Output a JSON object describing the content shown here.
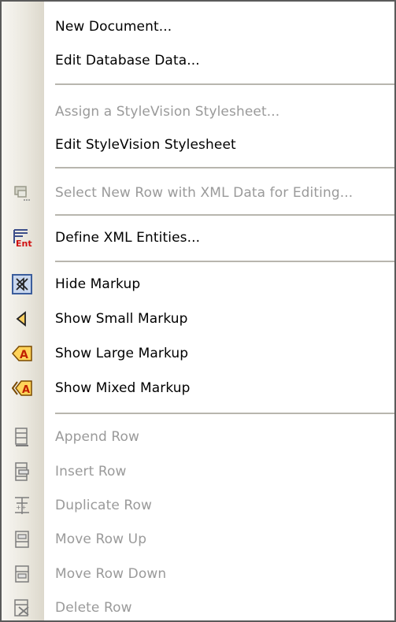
{
  "menu": {
    "items": [
      {
        "label": "New Document...",
        "enabled": true
      },
      {
        "label": "Edit Database Data...",
        "enabled": true
      },
      {
        "label": "Assign a StyleVision Stylesheet...",
        "enabled": false
      },
      {
        "label": "Edit StyleVision Stylesheet",
        "enabled": true
      },
      {
        "label": "Select New Row with XML Data for Editing...",
        "enabled": false,
        "icon": "xml-row-icon"
      },
      {
        "label": "Define XML Entities...",
        "enabled": true,
        "icon": "entities-icon"
      },
      {
        "label": "Hide Markup",
        "enabled": true,
        "icon": "hide-markup-icon",
        "checked": true
      },
      {
        "label": "Show Small Markup",
        "enabled": true,
        "icon": "small-markup-icon"
      },
      {
        "label": "Show Large Markup",
        "enabled": true,
        "icon": "large-markup-icon"
      },
      {
        "label": "Show Mixed Markup",
        "enabled": true,
        "icon": "mixed-markup-icon"
      },
      {
        "label": "Append Row",
        "enabled": false,
        "icon": "append-row-icon"
      },
      {
        "label": "Insert Row",
        "enabled": false,
        "icon": "insert-row-icon"
      },
      {
        "label": "Duplicate Row",
        "enabled": false,
        "icon": "duplicate-row-icon"
      },
      {
        "label": "Move Row Up",
        "enabled": false,
        "icon": "move-row-up-icon"
      },
      {
        "label": "Move Row Down",
        "enabled": false,
        "icon": "move-row-down-icon"
      },
      {
        "label": "Delete Row",
        "enabled": false,
        "icon": "delete-row-icon"
      }
    ]
  },
  "colors": {
    "enabled_text": "#000000",
    "disabled_text": "#9a9a9a",
    "separator": "#b8b6ae",
    "checked_border": "#3b5d9c",
    "checked_fill": "#c9d7ee",
    "markup_orange": "#e08a00"
  }
}
